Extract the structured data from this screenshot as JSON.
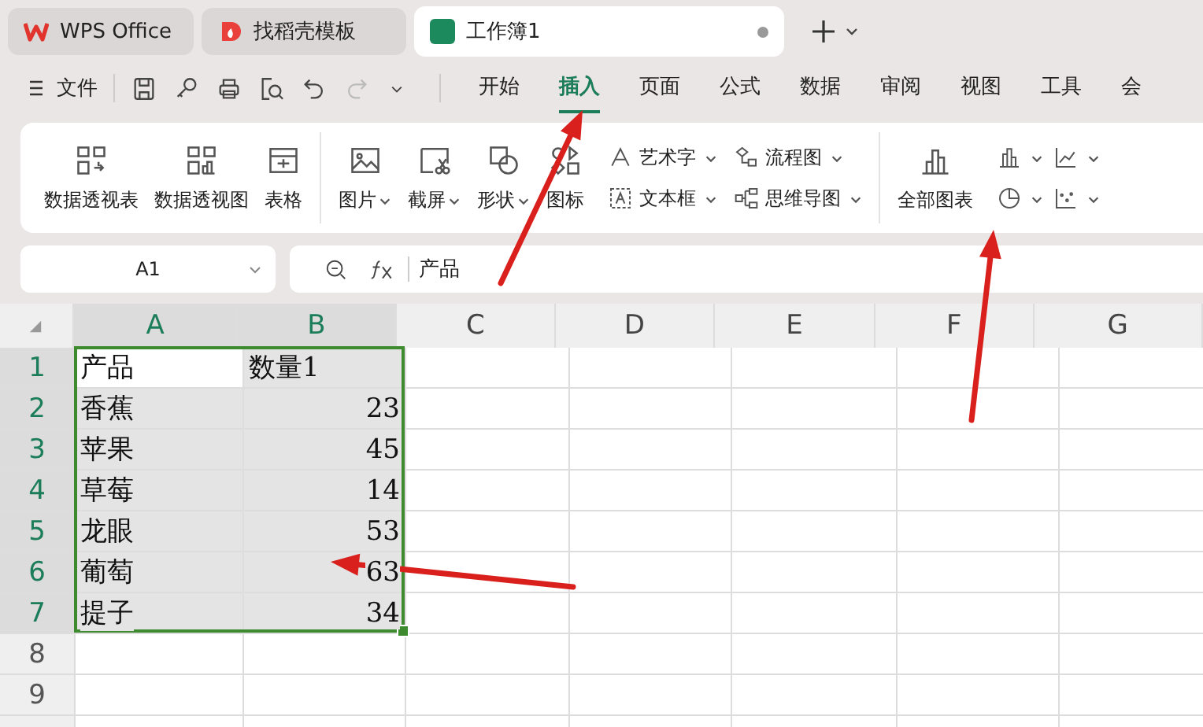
{
  "tabs": [
    {
      "label": "WPS Office",
      "kind": "wps",
      "selected": false
    },
    {
      "label": "找稻壳模板",
      "kind": "docer",
      "selected": false
    },
    {
      "label": "工作簿1",
      "kind": "sheet",
      "selected": true
    }
  ],
  "menu": {
    "file": "文件",
    "tabs": [
      {
        "label": "开始",
        "selected": false
      },
      {
        "label": "插入",
        "selected": true
      },
      {
        "label": "页面",
        "selected": false
      },
      {
        "label": "公式",
        "selected": false
      },
      {
        "label": "数据",
        "selected": false
      },
      {
        "label": "审阅",
        "selected": false
      },
      {
        "label": "视图",
        "selected": false
      },
      {
        "label": "工具",
        "selected": false
      },
      {
        "label": "会",
        "selected": false
      }
    ]
  },
  "ribbon": {
    "groups": [
      {
        "large": [
          {
            "label": "数据透视表",
            "dropdown": false
          },
          {
            "label": "数据透视图",
            "dropdown": false
          },
          {
            "label": "表格",
            "dropdown": false
          }
        ]
      },
      {
        "large": [
          {
            "label": "图片",
            "dropdown": true
          },
          {
            "label": "截屏",
            "dropdown": true
          },
          {
            "label": "形状",
            "dropdown": true
          },
          {
            "label": "图标",
            "dropdown": false
          }
        ],
        "small": [
          {
            "label": "艺术字",
            "dropdown": true
          },
          {
            "label": "文本框",
            "dropdown": true
          },
          {
            "label": "流程图",
            "dropdown": true
          },
          {
            "label": "思维导图",
            "dropdown": true
          }
        ]
      },
      {
        "large": [
          {
            "label": "全部图表",
            "dropdown": false
          }
        ],
        "small": [
          {
            "dropdown": true
          },
          {
            "dropdown": true
          },
          {
            "dropdown": true
          },
          {
            "dropdown": true
          }
        ]
      }
    ]
  },
  "formula_bar": {
    "name_box": "A1",
    "formula": "产品"
  },
  "sheet": {
    "columns": [
      {
        "label": "A",
        "selected": true
      },
      {
        "label": "B",
        "selected": true
      },
      {
        "label": "C",
        "selected": false
      },
      {
        "label": "D",
        "selected": false
      },
      {
        "label": "E",
        "selected": false
      },
      {
        "label": "F",
        "selected": false
      },
      {
        "label": "G",
        "selected": false
      }
    ],
    "rows": [
      {
        "number": "1",
        "selected": true,
        "cells": [
          {
            "text": "产品",
            "kind": "text",
            "active": true
          },
          {
            "text": "数量1",
            "kind": "text",
            "active": false
          }
        ]
      },
      {
        "number": "2",
        "selected": true,
        "cells": [
          {
            "text": "香蕉",
            "kind": "text",
            "active": false
          },
          {
            "text": "23",
            "kind": "number",
            "active": false
          }
        ]
      },
      {
        "number": "3",
        "selected": true,
        "cells": [
          {
            "text": "苹果",
            "kind": "text",
            "active": false
          },
          {
            "text": "45",
            "kind": "number",
            "active": false
          }
        ]
      },
      {
        "number": "4",
        "selected": true,
        "cells": [
          {
            "text": "草莓",
            "kind": "text",
            "active": false
          },
          {
            "text": "14",
            "kind": "number",
            "active": false
          }
        ]
      },
      {
        "number": "5",
        "selected": true,
        "cells": [
          {
            "text": "龙眼",
            "kind": "text",
            "active": false
          },
          {
            "text": "53",
            "kind": "number",
            "active": false
          }
        ]
      },
      {
        "number": "6",
        "selected": true,
        "cells": [
          {
            "text": "葡萄",
            "kind": "text",
            "active": false
          },
          {
            "text": "63",
            "kind": "number",
            "active": false
          }
        ]
      },
      {
        "number": "7",
        "selected": true,
        "cells": [
          {
            "text": "提子",
            "kind": "text",
            "active": false
          },
          {
            "text": "34",
            "kind": "number",
            "active": false
          }
        ]
      },
      {
        "number": "8",
        "selected": false,
        "cells": []
      },
      {
        "number": "9",
        "selected": false,
        "cells": []
      }
    ]
  }
}
